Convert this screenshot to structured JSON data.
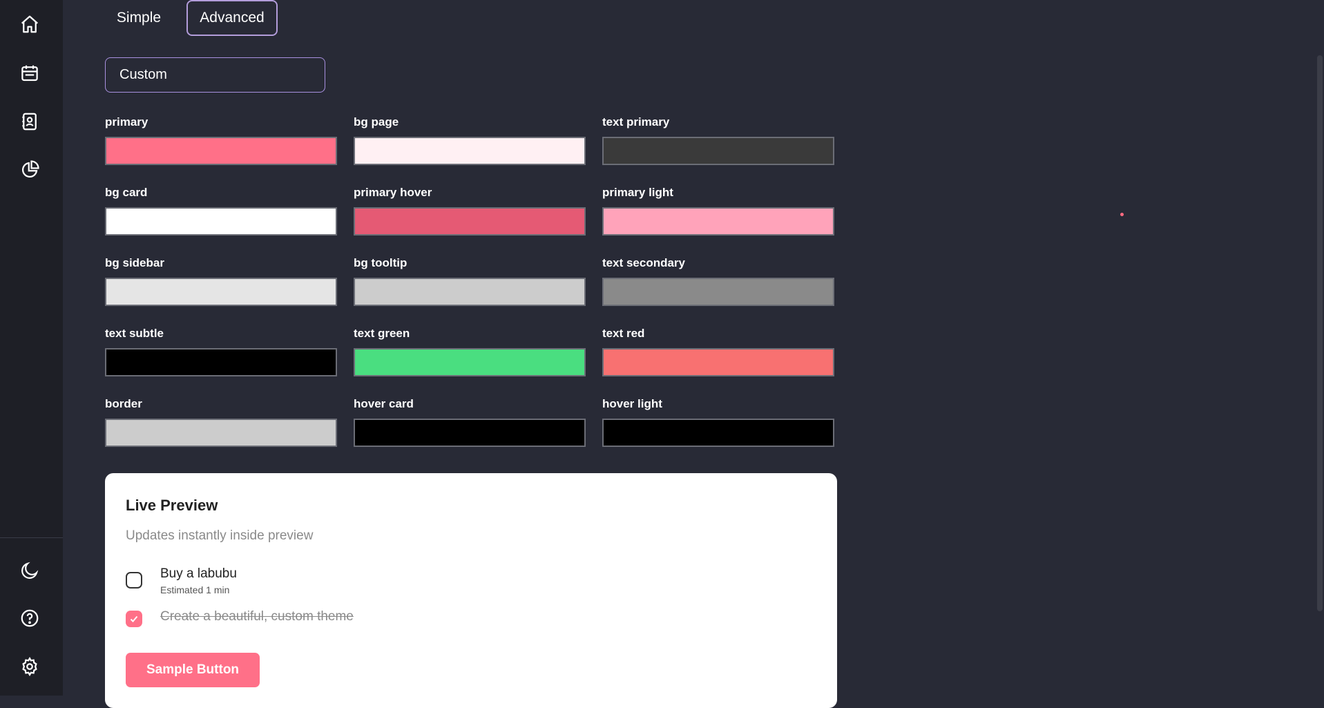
{
  "sidebar": {
    "icons": [
      "home-icon",
      "calendar-icon",
      "contacts-icon",
      "pie-chart-icon",
      "moon-icon",
      "help-icon",
      "gear-icon"
    ]
  },
  "tabs": [
    {
      "label": "Simple",
      "active": false
    },
    {
      "label": "Advanced",
      "active": true
    }
  ],
  "preset": {
    "value": "Custom"
  },
  "colors": [
    {
      "label": "primary",
      "value": "#ff7088"
    },
    {
      "label": "bg page",
      "value": "#fff0f3"
    },
    {
      "label": "text primary",
      "value": "#3a3a3a"
    },
    {
      "label": "bg card",
      "value": "#ffffff"
    },
    {
      "label": "primary hover",
      "value": "#e55a74"
    },
    {
      "label": "primary light",
      "value": "#ffa3ba"
    },
    {
      "label": "bg sidebar",
      "value": "#e5e5e5"
    },
    {
      "label": "bg tooltip",
      "value": "#cccccc"
    },
    {
      "label": "text secondary",
      "value": "#8a8a8a"
    },
    {
      "label": "text subtle",
      "value": "#000000"
    },
    {
      "label": "text green",
      "value": "#4ade80"
    },
    {
      "label": "text red",
      "value": "#f87171"
    },
    {
      "label": "border",
      "value": "#cccccc"
    },
    {
      "label": "hover card",
      "value": "#000000"
    },
    {
      "label": "hover light",
      "value": "#000000"
    }
  ],
  "preview": {
    "title": "Live Preview",
    "subtitle": "Updates instantly inside preview",
    "tasks": [
      {
        "title": "Buy a labubu",
        "meta": "Estimated 1 min",
        "done": false
      },
      {
        "title": "Create a beautiful, custom theme",
        "meta": "",
        "done": true
      }
    ],
    "button_label": "Sample Button"
  }
}
